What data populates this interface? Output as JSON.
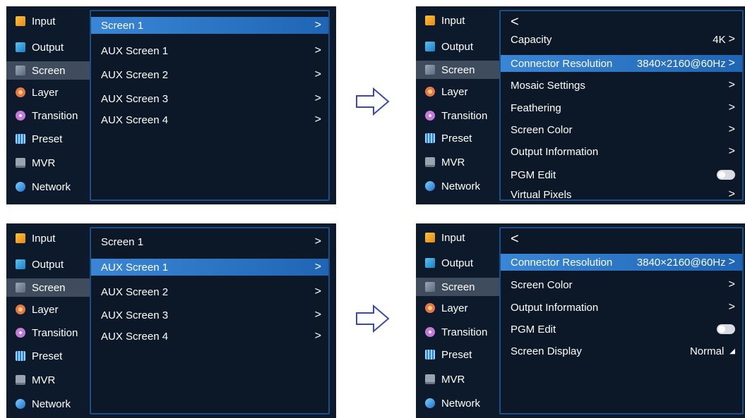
{
  "sidebar": {
    "items": [
      {
        "label": "Input",
        "icon": "input-icon"
      },
      {
        "label": "Output",
        "icon": "output-icon"
      },
      {
        "label": "Screen",
        "icon": "screen-icon"
      },
      {
        "label": "Layer",
        "icon": "layer-icon"
      },
      {
        "label": "Transition",
        "icon": "transition-icon"
      },
      {
        "label": "Preset",
        "icon": "preset-icon"
      },
      {
        "label": "MVR",
        "icon": "mvr-icon"
      },
      {
        "label": "Network",
        "icon": "network-icon"
      }
    ],
    "active": "Screen"
  },
  "panel_tl": {
    "rows": [
      {
        "label": "Screen 1",
        "chev": ">"
      },
      {
        "label": "AUX Screen 1",
        "chev": ">"
      },
      {
        "label": "AUX Screen 2",
        "chev": ">"
      },
      {
        "label": "AUX Screen 3",
        "chev": ">"
      },
      {
        "label": "AUX Screen 4",
        "chev": ">"
      }
    ],
    "selected": "Screen 1"
  },
  "panel_tr": {
    "back": "<",
    "rows": [
      {
        "label": "Capacity",
        "value": "4K",
        "chev": ">"
      },
      {
        "label": "Connector Resolution",
        "value": "3840×2160@60Hz",
        "chev": ">"
      },
      {
        "label": "Mosaic Settings",
        "value": "",
        "chev": ">"
      },
      {
        "label": "Feathering",
        "value": "",
        "chev": ">"
      },
      {
        "label": "Screen Color",
        "value": "",
        "chev": ">"
      },
      {
        "label": "Output Information",
        "value": "",
        "chev": ">"
      },
      {
        "label": "PGM Edit",
        "value": "",
        "chev": ""
      },
      {
        "label": "Virtual Pixels",
        "value": "",
        "chev": ">"
      }
    ],
    "selected": "Connector Resolution",
    "pgm_edit_toggle": "off"
  },
  "panel_bl": {
    "rows": [
      {
        "label": "Screen 1",
        "chev": ">"
      },
      {
        "label": "AUX Screen 1",
        "chev": ">"
      },
      {
        "label": "AUX Screen 2",
        "chev": ">"
      },
      {
        "label": "AUX Screen 3",
        "chev": ">"
      },
      {
        "label": "AUX Screen 4",
        "chev": ">"
      }
    ],
    "selected": "AUX Screen 1"
  },
  "panel_br": {
    "back": "<",
    "rows": [
      {
        "label": "Connector Resolution",
        "value": "3840×2160@60Hz",
        "chev": ">"
      },
      {
        "label": "Screen Color",
        "value": "",
        "chev": ">"
      },
      {
        "label": "Output Information",
        "value": "",
        "chev": ">"
      },
      {
        "label": "PGM Edit",
        "value": "",
        "chev": ""
      },
      {
        "label": "Screen Display",
        "value": "Normal",
        "chev": ""
      }
    ],
    "selected": "Connector Resolution",
    "pgm_edit_toggle": "off"
  },
  "colors": {
    "panel_bg": "#0d1a2c",
    "selected_row": "#2f7ed0",
    "sidebar_active": "#3e4c5e",
    "menu_border": "#1d4f86",
    "arrow": "#3b4aa8"
  }
}
